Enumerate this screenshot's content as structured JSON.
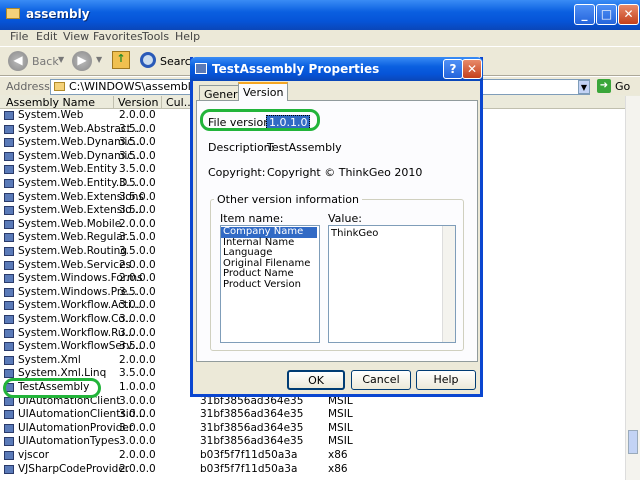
{
  "window": {
    "title": "assembly"
  },
  "menu": [
    "File",
    "Edit",
    "View",
    "Favorites",
    "Tools",
    "Help"
  ],
  "toolbar": {
    "back": "Back",
    "search": "Search"
  },
  "address": {
    "label": "Address",
    "value": "C:\\WINDOWS\\assembly",
    "go": "Go"
  },
  "list": {
    "headers": [
      "Assembly Name",
      "Version",
      "Cul..."
    ],
    "rows": [
      [
        "System.Web",
        "2.0.0.0",
        "",
        ""
      ],
      [
        "System.Web.Abstract...",
        "3.5.0.0",
        "",
        ""
      ],
      [
        "System.Web.Dynamic...",
        "3.5.0.0",
        "",
        ""
      ],
      [
        "System.Web.Dynamic...",
        "3.5.0.0",
        "",
        ""
      ],
      [
        "System.Web.Entity",
        "3.5.0.0",
        "",
        ""
      ],
      [
        "System.Web.Entity.D...",
        "3.5.0.0",
        "",
        ""
      ],
      [
        "System.Web.Extensions",
        "3.5.0.0",
        "",
        ""
      ],
      [
        "System.Web.Extensio...",
        "3.5.0.0",
        "",
        ""
      ],
      [
        "System.Web.Mobile",
        "2.0.0.0",
        "",
        ""
      ],
      [
        "System.Web.Regular...",
        "3.5.0.0",
        "",
        ""
      ],
      [
        "System.Web.Routing",
        "3.5.0.0",
        "",
        ""
      ],
      [
        "System.Web.Services",
        "2.0.0.0",
        "",
        ""
      ],
      [
        "System.Windows.Forms",
        "2.0.0.0",
        "",
        ""
      ],
      [
        "System.Windows.Pre...",
        "3.5.0.0",
        "",
        ""
      ],
      [
        "System.Workflow.Acti...",
        "3.0.0.0",
        "",
        ""
      ],
      [
        "System.Workflow.Co...",
        "3.0.0.0",
        "",
        ""
      ],
      [
        "System.Workflow.Ru...",
        "3.0.0.0",
        "",
        ""
      ],
      [
        "System.WorkflowServ...",
        "3.5.0.0",
        "",
        ""
      ],
      [
        "System.Xml",
        "2.0.0.0",
        "",
        ""
      ],
      [
        "System.Xml.Linq",
        "3.5.0.0",
        "",
        ""
      ],
      [
        "TestAssembly",
        "1.0.0.0",
        "",
        ""
      ],
      [
        "UIAutomationClient",
        "3.0.0.0",
        "31bf3856ad364e35",
        "MSIL"
      ],
      [
        "UIAutomationClientsid...",
        "3.0.0.0",
        "31bf3856ad364e35",
        "MSIL"
      ],
      [
        "UIAutomationProvider",
        "3.0.0.0",
        "31bf3856ad364e35",
        "MSIL"
      ],
      [
        "UIAutomationTypes",
        "3.0.0.0",
        "31bf3856ad364e35",
        "MSIL"
      ],
      [
        "vjscor",
        "2.0.0.0",
        "b03f5f7f11d50a3a",
        "x86"
      ],
      [
        "VJSharpCodeProvider",
        "2.0.0.0",
        "b03f5f7f11d50a3a",
        "x86"
      ]
    ]
  },
  "dialog": {
    "title": "TestAssembly Properties",
    "tabs": [
      "General",
      "Version"
    ],
    "file_version_label": "File version:",
    "file_version": "1.0.1.0",
    "description_label": "Description:",
    "description": "TestAssembly",
    "copyright_label": "Copyright:",
    "copyright": "Copyright © ThinkGeo 2010",
    "group_label": "Other version information",
    "item_name_label": "Item name:",
    "value_label": "Value:",
    "items": [
      "Company Name",
      "Internal Name",
      "Language",
      "Original Filename",
      "Product Name",
      "Product Version"
    ],
    "value": "ThinkGeo",
    "ok": "OK",
    "cancel": "Cancel",
    "help": "Help"
  }
}
